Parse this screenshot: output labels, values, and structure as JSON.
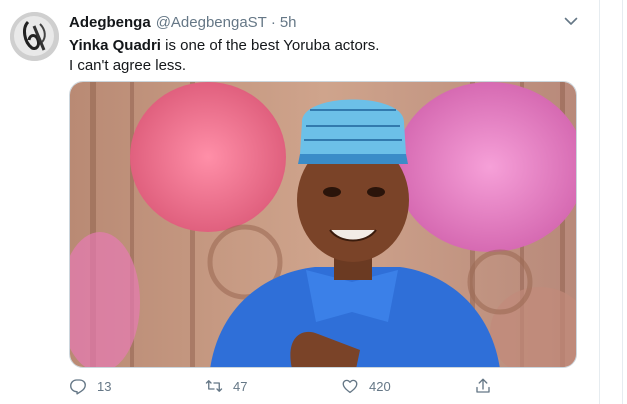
{
  "tweet": {
    "author_name": "Adegbenga",
    "author_handle": "@AdegbengaST",
    "separator": "·",
    "time": "5h",
    "text_bold": "Yinka Quadri",
    "text_rest": " is one of the best Yoruba actors.",
    "text_line2": "I can't agree less.",
    "reply_count": "13",
    "retweet_count": "47",
    "like_count": "420"
  },
  "icons": {
    "caret": "chevron-down-icon",
    "reply": "reply-icon",
    "retweet": "retweet-icon",
    "like": "heart-icon",
    "share": "share-icon"
  },
  "colors": {
    "text_primary": "#14171a",
    "text_secondary": "#657786",
    "border": "#e6ecf0"
  }
}
